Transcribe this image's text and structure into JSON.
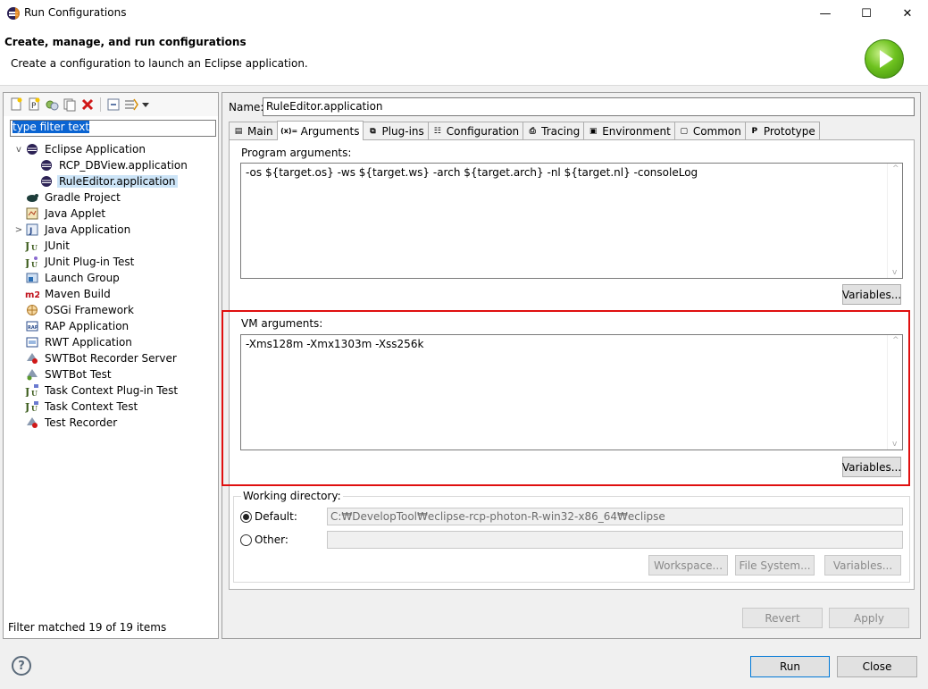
{
  "window": {
    "title": "Run Configurations",
    "minimize_glyph": "—",
    "maximize_glyph": "☐",
    "close_glyph": "✕"
  },
  "banner": {
    "title": "Create, manage, and run configurations",
    "description": "Create a configuration to launch an Eclipse application."
  },
  "left": {
    "filter_placeholder": "type filter text",
    "tree": [
      {
        "label": "Eclipse Application",
        "level": 0,
        "twisty": "v",
        "icon": "eclipse-icon"
      },
      {
        "label": "RCP_DBView.application",
        "level": 1,
        "twisty": "",
        "icon": "eclipse-icon"
      },
      {
        "label": "RuleEditor.application",
        "level": 1,
        "twisty": "",
        "icon": "eclipse-icon",
        "selected": true
      },
      {
        "label": "Gradle Project",
        "level": 0,
        "twisty": "",
        "icon": "gradle-icon"
      },
      {
        "label": "Java Applet",
        "level": 0,
        "twisty": "",
        "icon": "java-applet-icon"
      },
      {
        "label": "Java Application",
        "level": 0,
        "twisty": ">",
        "icon": "java-application-icon"
      },
      {
        "label": "JUnit",
        "level": 0,
        "twisty": "",
        "icon": "junit-icon"
      },
      {
        "label": "JUnit Plug-in Test",
        "level": 0,
        "twisty": "",
        "icon": "junit-plugin-icon"
      },
      {
        "label": "Launch Group",
        "level": 0,
        "twisty": "",
        "icon": "launch-group-icon"
      },
      {
        "label": "Maven Build",
        "level": 0,
        "twisty": "",
        "icon": "maven-icon"
      },
      {
        "label": "OSGi Framework",
        "level": 0,
        "twisty": "",
        "icon": "osgi-icon"
      },
      {
        "label": "RAP Application",
        "level": 0,
        "twisty": "",
        "icon": "rap-icon"
      },
      {
        "label": "RWT Application",
        "level": 0,
        "twisty": "",
        "icon": "rwt-icon"
      },
      {
        "label": "SWTBot Recorder Server",
        "level": 0,
        "twisty": "",
        "icon": "swtbot-recorder-icon"
      },
      {
        "label": "SWTBot Test",
        "level": 0,
        "twisty": "",
        "icon": "swtbot-test-icon"
      },
      {
        "label": "Task Context Plug-in Test",
        "level": 0,
        "twisty": "",
        "icon": "task-context-plugin-icon"
      },
      {
        "label": "Task Context Test",
        "level": 0,
        "twisty": "",
        "icon": "task-context-icon"
      },
      {
        "label": "Test Recorder",
        "level": 0,
        "twisty": "",
        "icon": "test-recorder-icon"
      }
    ],
    "status": "Filter matched 19 of 19 items"
  },
  "right": {
    "name_label": "Name:",
    "name_value": "RuleEditor.application",
    "tabs": [
      {
        "label": "Main",
        "icon": "main-tab-icon",
        "glyph": "▤"
      },
      {
        "label": "Arguments",
        "icon": "arguments-tab-icon",
        "glyph": "(x)=",
        "active": true
      },
      {
        "label": "Plug-ins",
        "icon": "plugins-tab-icon",
        "glyph": "⧉"
      },
      {
        "label": "Configuration",
        "icon": "configuration-tab-icon",
        "glyph": "☷"
      },
      {
        "label": "Tracing",
        "icon": "tracing-tab-icon",
        "glyph": "⎙"
      },
      {
        "label": "Environment",
        "icon": "environment-tab-icon",
        "glyph": "▣"
      },
      {
        "label": "Common",
        "icon": "common-tab-icon",
        "glyph": "▢"
      },
      {
        "label": "Prototype",
        "icon": "prototype-tab-icon",
        "glyph": "P"
      }
    ],
    "program_args": {
      "label": "Program arguments:",
      "value": "-os ${target.os} -ws ${target.ws} -arch ${target.arch} -nl ${target.nl} -consoleLog",
      "variables_button": "Variables..."
    },
    "vm_args": {
      "label": "VM arguments:",
      "value": "-Xms128m -Xmx1303m -Xss256k",
      "variables_button": "Variables..."
    },
    "working_dir": {
      "label": "Working directory:",
      "default_label": "Default:",
      "default_value": "C:₩DevelopTool₩eclipse-rcp-photon-R-win32-x86_64₩eclipse",
      "other_label": "Other:",
      "other_value": "",
      "workspace_button": "Workspace...",
      "filesystem_button": "File System...",
      "variables_button": "Variables..."
    },
    "revert_button": "Revert",
    "apply_button": "Apply"
  },
  "footer": {
    "help_glyph": "?",
    "run_button": "Run",
    "close_button": "Close"
  },
  "colors": {
    "highlight": "#e01010",
    "selection": "#cce4f7",
    "run_green": "#6ec21f"
  }
}
